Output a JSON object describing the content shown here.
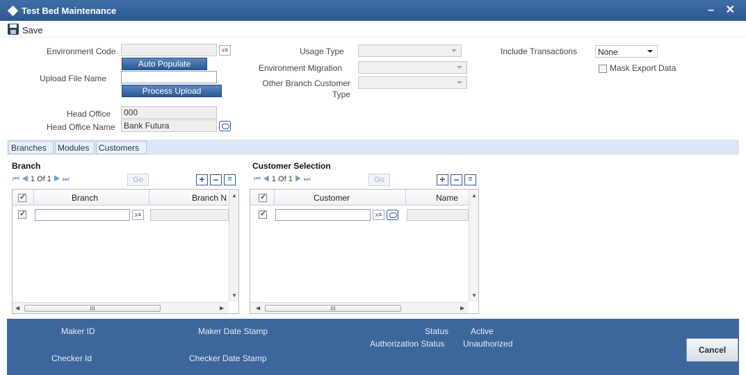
{
  "window": {
    "title": "Test Bed Maintenance",
    "controls": "– ✕"
  },
  "toolbar": {
    "save_label": "Save",
    "save_icon": "save-icon"
  },
  "form": {
    "environment_code": {
      "label": "Environment Code",
      "value": ""
    },
    "auto_populate_label": "Auto Populate",
    "upload_file_name": {
      "label": "Upload File Name",
      "value": ""
    },
    "process_upload_label": "Process Upload",
    "head_office": {
      "label": "Head Office",
      "value": "000"
    },
    "head_office_name": {
      "label": "Head Office Name",
      "value": "Bank Futura"
    },
    "usage_type": {
      "label": "Usage Type",
      "value": ""
    },
    "environment_migration": {
      "label": "Environment Migration",
      "value": ""
    },
    "other_branch_customer_type": {
      "label_line1": "Other Branch Customer",
      "label_line2": "Type",
      "value": ""
    },
    "include_transactions": {
      "label": "Include Transactions",
      "value": "None"
    },
    "mask_export_data": {
      "label": "Mask Export Data",
      "checked": false
    }
  },
  "tabs": [
    {
      "label": "Branches",
      "active": true
    },
    {
      "label": "Modules",
      "active": false
    },
    {
      "label": "Customers",
      "active": false
    }
  ],
  "branch_grid": {
    "title": "Branch",
    "pager": {
      "current": "1",
      "of_label": "Of",
      "total": "1",
      "go_label": "Go"
    },
    "columns": [
      "Branch",
      "Branch N"
    ],
    "rows": [
      {
        "checked": true,
        "branch": "",
        "branch_name": ""
      }
    ],
    "scroll_thumb": "III"
  },
  "customer_grid": {
    "title": "Customer Selection",
    "pager": {
      "current": "1",
      "of_label": "Of",
      "total": "1",
      "go_label": "Go"
    },
    "columns": [
      "Customer",
      "Name"
    ],
    "rows": [
      {
        "checked": true,
        "customer": "",
        "name": ""
      }
    ],
    "scroll_thumb": "III"
  },
  "footer": {
    "maker_id_label": "Maker ID",
    "maker_date_stamp_label": "Maker Date Stamp",
    "checker_id_label": "Checker Id",
    "checker_date_stamp_label": "Checker Date Stamp",
    "status_label": "Status",
    "status_value": "Active",
    "authorization_status_label": "Authorization Status",
    "authorization_status_value": "Unauthorized",
    "cancel_label": "Cancel"
  },
  "colors": {
    "accent": "#2c5893",
    "footer_bg": "#3d679c",
    "tabstrip_bg": "#dbe6f4"
  }
}
